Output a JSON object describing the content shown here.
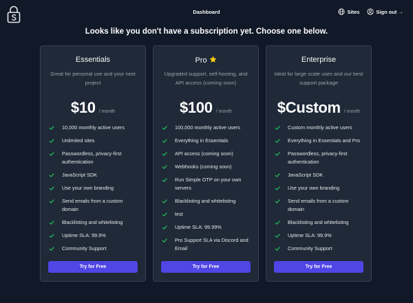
{
  "nav": {
    "dashboard": "Dashboard",
    "sites": "Sites",
    "sign_out": "Sign out →"
  },
  "headline": "Looks like you don't have a subscription yet. Choose one below.",
  "colors": {
    "background": "#111827",
    "card": "#1f2937",
    "card_border": "#374151",
    "accent": "#4f46e5",
    "check": "#22c55e",
    "muted_text": "#9ca3af"
  },
  "plans": [
    {
      "name": "Essentials",
      "badge_icon": null,
      "description": "Great for personal use and your next project",
      "price": "$10",
      "period": "/ month",
      "features": [
        "10,000 monthly active users",
        "Unlimited sites",
        "Passwordless, privacy-first authentication",
        "JavaScript SDK",
        "Use your own branding",
        "Send emails from a custom domain",
        "Blacklisting and whitelisting",
        "Uptime SLA: 99.9%",
        "Community Support"
      ],
      "cta": "Try for Free"
    },
    {
      "name": "Pro",
      "badge_icon": "star-icon",
      "description": "Upgraded support, self-hosting, and API access (coming soon)",
      "price": "$100",
      "period": "/ month",
      "features": [
        "100,000 monthly active users",
        "Everything in Essentials",
        "API access (coming soon)",
        "Webhooks (coming soon)",
        "Run Simple OTP on your own servers",
        "Blacklisting and whitelisting",
        "test",
        "Uptime SLA: 99.99%",
        "Pro Support SLA via Discord and Email"
      ],
      "cta": "Try for Free"
    },
    {
      "name": "Enterprise",
      "badge_icon": null,
      "description": "Ideal for large scale uses and our best support package",
      "price": "$Custom",
      "period": "/ month",
      "features": [
        "Custom monthly active users",
        "Everything in Essentials and Pro",
        "Passwordless, privacy-first authentication",
        "JavaScript SDK",
        "Use your own branding",
        "Send emails from a custom domain",
        "Blacklisting and whitelisting",
        "Uptime SLA: 99.9%",
        "Community Support"
      ],
      "cta": "Try for Free"
    }
  ]
}
